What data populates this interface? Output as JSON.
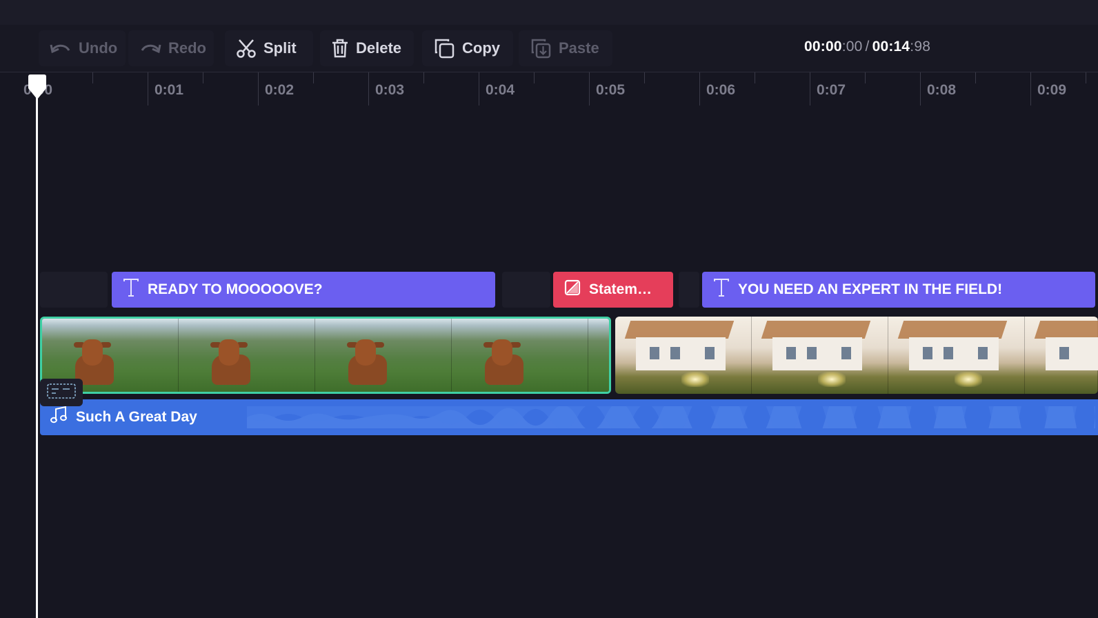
{
  "toolbar": {
    "undo_label": "Undo",
    "redo_label": "Redo",
    "split_label": "Split",
    "delete_label": "Delete",
    "copy_label": "Copy",
    "paste_label": "Paste"
  },
  "timecode": {
    "current_main": "00:00",
    "current_frames": ":00",
    "separator": "/",
    "total_main": "00:14",
    "total_frames": ":98"
  },
  "ruler": {
    "labels": [
      "0:00",
      "0:01",
      "0:02",
      "0:03",
      "0:04",
      "0:05",
      "0:06",
      "0:07",
      "0:08",
      "0:09"
    ]
  },
  "tracks": {
    "text_clip_1": "READY TO MOOOOOVE?",
    "statement_clip": "Statem…",
    "text_clip_2": "YOU NEED AN EXPERT IN THE FIELD!",
    "audio_label": "Such A Great Day"
  },
  "icons": {
    "undo": "undo-arrow-icon",
    "redo": "redo-arrow-icon",
    "split": "scissors-icon",
    "delete": "trash-icon",
    "copy": "copy-icon",
    "paste": "paste-icon",
    "text": "text-t-icon",
    "sticker": "sticker-icon",
    "music": "music-note-icon",
    "captions": "captions-icon"
  },
  "colors": {
    "text_clip": "#6b5ff0",
    "statement_clip": "#e53e5a",
    "audio_clip": "#3b6fe0",
    "selected_outline": "#3fd0a4"
  }
}
